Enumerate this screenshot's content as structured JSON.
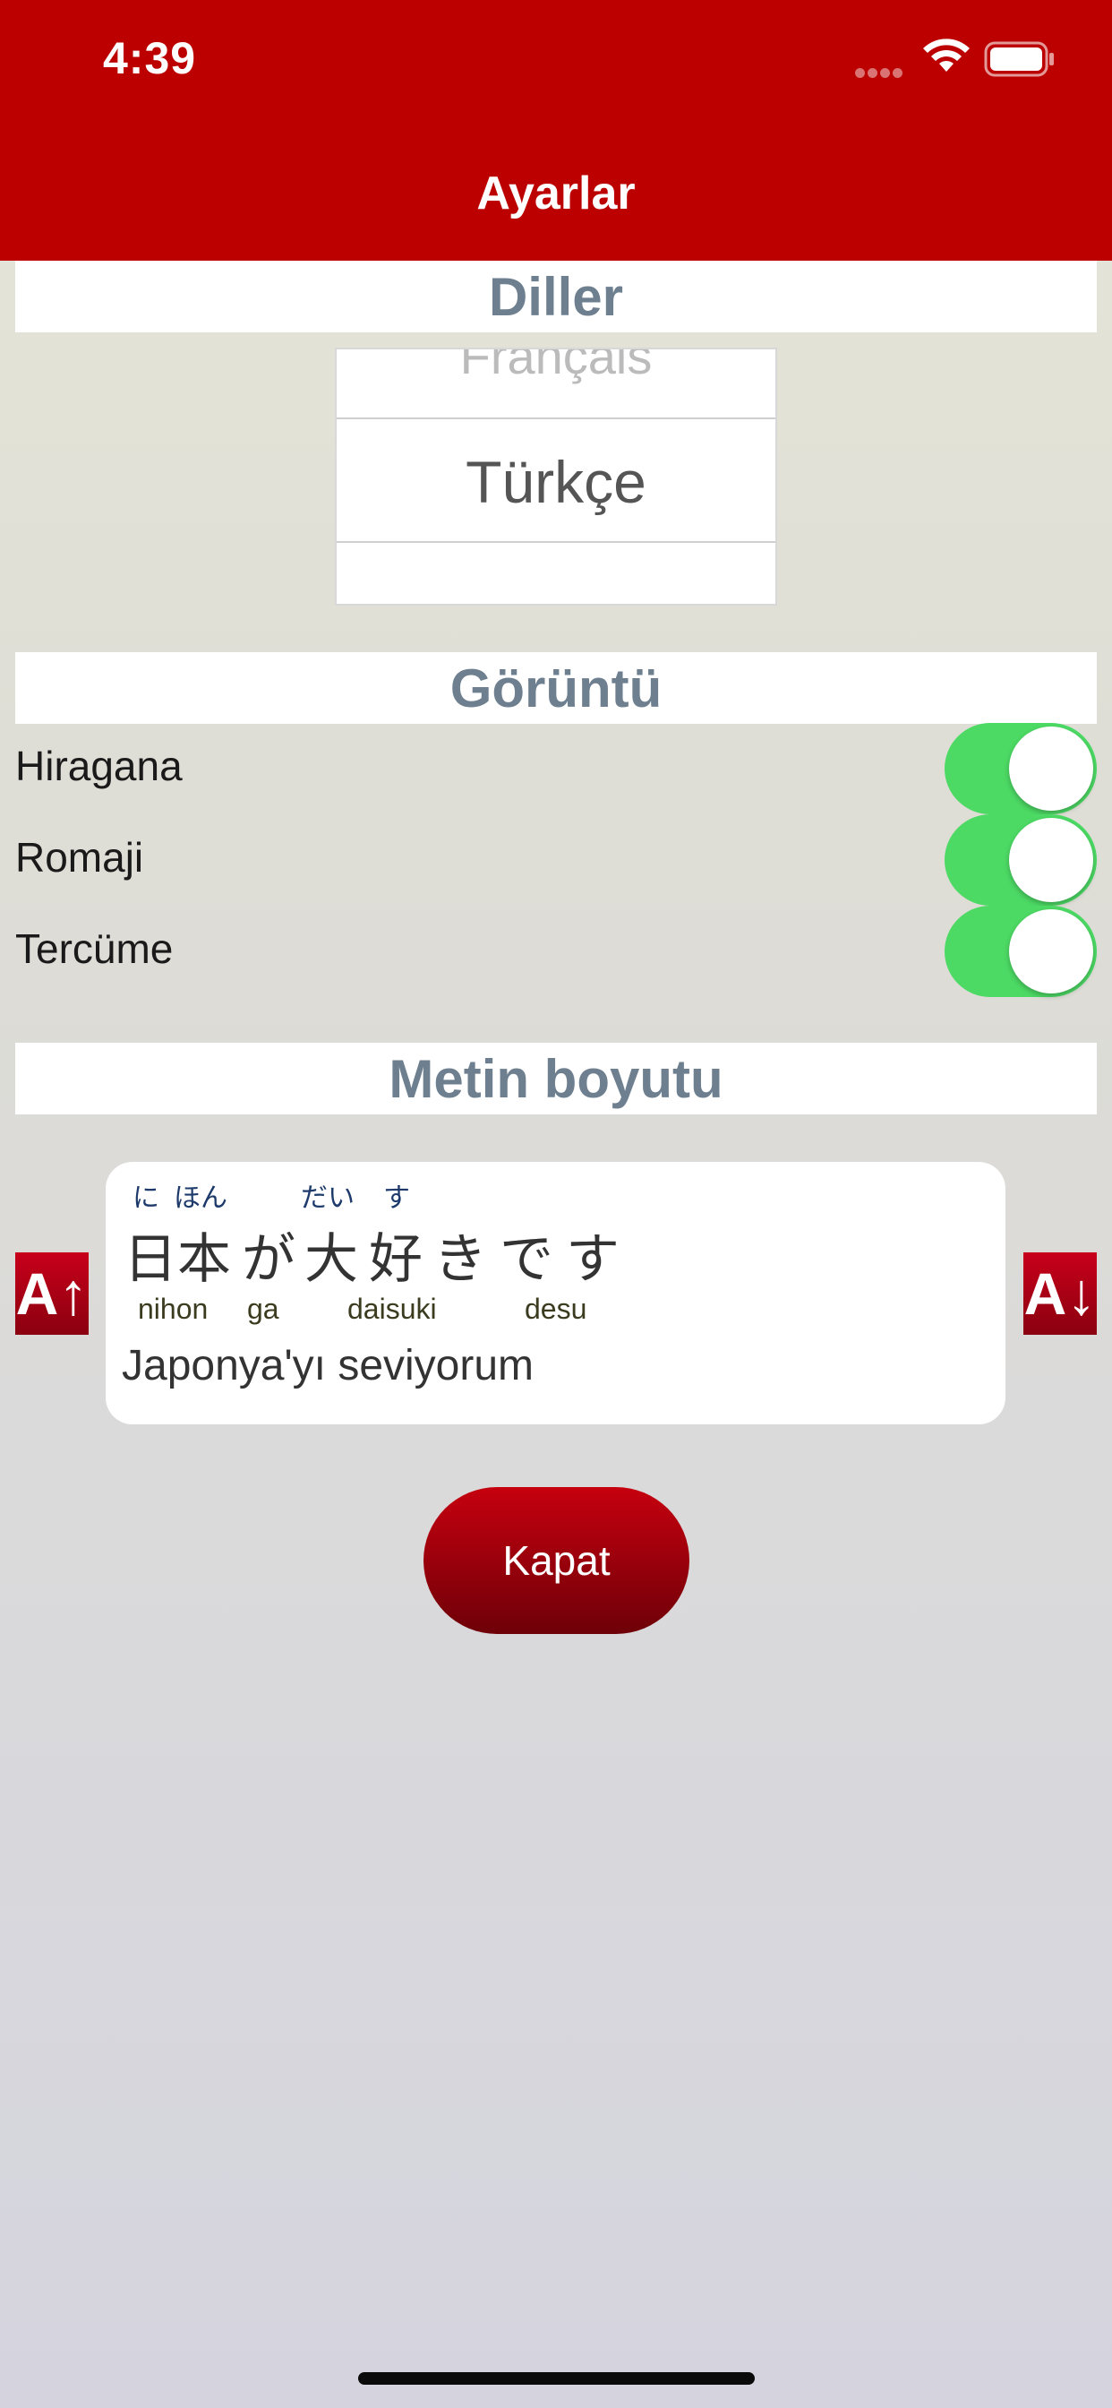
{
  "status": {
    "time": "4:39"
  },
  "nav": {
    "title": "Ayarlar"
  },
  "languages": {
    "header": "Diller",
    "picker_prev": "Français",
    "picker_selected": "Türkçe"
  },
  "display": {
    "header": "Görüntü",
    "options": [
      {
        "label": "Hiragana",
        "on": true
      },
      {
        "label": "Romaji",
        "on": true
      },
      {
        "label": "Tercüme",
        "on": true
      }
    ]
  },
  "text_size": {
    "header": "Metin boyutu",
    "increase_label": "A↑",
    "decrease_label": "A↓",
    "sample": {
      "furigana": [
        "に",
        "ほん",
        "だい",
        "す"
      ],
      "kanji": [
        "日",
        "本",
        "が",
        "大",
        "好",
        "き",
        "で",
        "す"
      ],
      "romaji": [
        "nihon",
        "ga",
        "daisuki",
        "desu"
      ],
      "translation": "Japonya'yı seviyorum"
    }
  },
  "close_button": "Kapat",
  "colors": {
    "header_red": "#bc0000",
    "toggle_green": "#4cd964",
    "section_title": "#6e7f8f"
  }
}
